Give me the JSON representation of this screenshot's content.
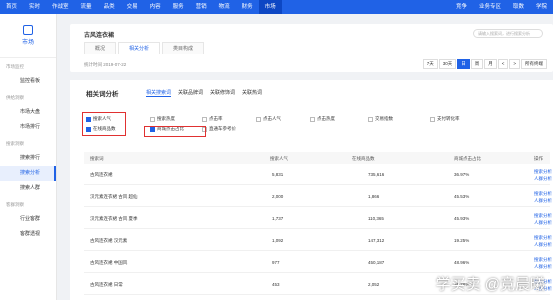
{
  "topnav": [
    "首页",
    "实时",
    "作战室",
    "流量",
    "品类",
    "交易",
    "内容",
    "服务",
    "营销",
    "物流",
    "财务",
    "市场",
    "竞争",
    "业务专区",
    "取数",
    "学院"
  ],
  "sidebar": {
    "title": "市场",
    "groups": [
      {
        "label": "市场监控",
        "items": [
          "监控看板"
        ]
      },
      {
        "label": "供给洞察",
        "items": [
          "市场大盘",
          "市场排行"
        ]
      },
      {
        "label": "搜索洞察",
        "items": [
          "搜索排行",
          "搜索分析",
          "搜索人群"
        ]
      },
      {
        "label": "客群洞察",
        "items": [
          "行业客群",
          "客群透视"
        ]
      }
    ]
  },
  "header": {
    "shop": "古风连衣裙",
    "search_placeholder": "请输入搜索词，进行搜索分析",
    "tabs": [
      "概况",
      "相关分析",
      "类目构成"
    ],
    "stat_time": "统计时间 2019-07-22",
    "date_buttons": [
      "7天",
      "30天",
      "日",
      "周",
      "月",
      "<",
      ">"
    ],
    "terminal": "所有终端"
  },
  "section": {
    "title": "相关词分析",
    "subtabs": [
      "相关搜索词",
      "关联品牌词",
      "关联修饰词",
      "关联热词"
    ],
    "options": [
      {
        "label": "搜索人气",
        "checked": true
      },
      {
        "label": "搜索热度",
        "checked": false
      },
      {
        "label": "点击率",
        "checked": false
      },
      {
        "label": "点击人气",
        "checked": false
      },
      {
        "label": "点击热度",
        "checked": false
      },
      {
        "label": "交易指数",
        "checked": false
      },
      {
        "label": "支付转化率",
        "checked": false
      },
      {
        "label": "在线商品数",
        "checked": true
      },
      {
        "label": "商城点击占比",
        "checked": true
      },
      {
        "label": "直通车参考价",
        "checked": false
      }
    ]
  },
  "table": {
    "headers": [
      "搜索词",
      "搜索人气",
      "在线商品数",
      "商城点击占比",
      "操作"
    ],
    "rows": [
      {
        "word": "古风连衣裙",
        "popularity": "5,831",
        "items": "735,616",
        "ratio": "36.97%",
        "a1": "搜索分析",
        "a2": "人群分析"
      },
      {
        "word": "汉元素连衣裙 古风 超仙",
        "popularity": "2,000",
        "items": "1,866",
        "ratio": "45.53%",
        "a1": "搜索分析",
        "a2": "人群分析"
      },
      {
        "word": "汉元素连衣裙 古风 夏季",
        "popularity": "1,737",
        "items": "110,365",
        "ratio": "45.93%",
        "a1": "搜索分析",
        "a2": "人群分析"
      },
      {
        "word": "古风连衣裙 汉元素",
        "popularity": "1,092",
        "items": "147,312",
        "ratio": "19.25%",
        "a1": "搜索分析",
        "a2": "人群分析"
      },
      {
        "word": "古风连衣裙 中国风",
        "popularity": "977",
        "items": "450,187",
        "ratio": "48.96%",
        "a1": "搜索分析",
        "a2": "人群分析"
      },
      {
        "word": "古风连衣裙 日常",
        "popularity": "453",
        "items": "2,052",
        "ratio": "26.78%",
        "a1": "搜索分析",
        "a2": "人群分析"
      }
    ]
  },
  "watermark": "学买卖 @竞晨曦"
}
